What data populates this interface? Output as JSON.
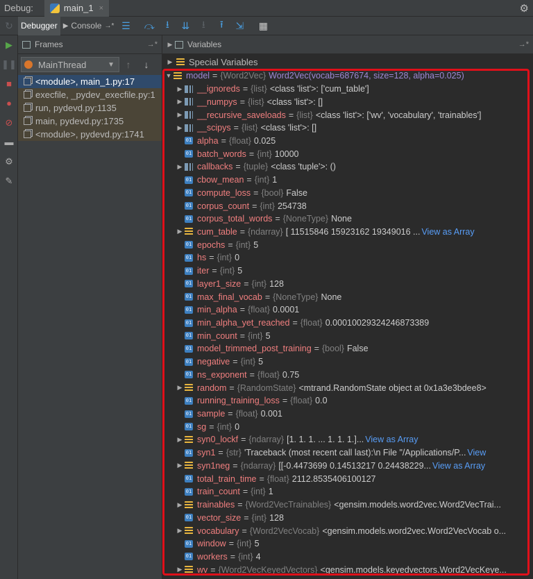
{
  "title_bar": {
    "debug_label": "Debug:",
    "run_tab_label": "main_1",
    "close_glyph": "×",
    "settings_icon": "gear-icon"
  },
  "toolbar": {
    "debugger_tab": "Debugger",
    "console_tab": "Console",
    "console_extra": "→*"
  },
  "frames": {
    "header": "Frames",
    "pin_glyph": "→*",
    "thread": "MainThread",
    "items": [
      "<module>, main_1.py:17",
      "execfile, _pydev_execfile.py:1",
      "run, pydevd.py:1135",
      "main, pydevd.py:1735",
      "<module>, pydevd.py:1741"
    ]
  },
  "variables": {
    "header": "Variables",
    "pin_glyph": "→*",
    "special": "Special Variables",
    "root": {
      "name": "model",
      "type": "{Word2Vec}",
      "value": "Word2Vec(vocab=687674, size=128, alpha=0.025)"
    },
    "rows": [
      {
        "name": "__ignoreds",
        "type": "{list}",
        "value": "<class 'list'>: ['cum_table']",
        "icon": "list",
        "expandable": true
      },
      {
        "name": "__numpys",
        "type": "{list}",
        "value": "<class 'list'>: []",
        "icon": "list",
        "expandable": true
      },
      {
        "name": "__recursive_saveloads",
        "type": "{list}",
        "value": "<class 'list'>: ['wv', 'vocabulary', 'trainables']",
        "icon": "list",
        "expandable": true
      },
      {
        "name": "__scipys",
        "type": "{list}",
        "value": "<class 'list'>: []",
        "icon": "list",
        "expandable": true
      },
      {
        "name": "alpha",
        "type": "{float}",
        "value": "0.025",
        "icon": "num",
        "expandable": false
      },
      {
        "name": "batch_words",
        "type": "{int}",
        "value": "10000",
        "icon": "num",
        "expandable": false
      },
      {
        "name": "callbacks",
        "type": "{tuple}",
        "value": "<class 'tuple'>: ()",
        "icon": "list",
        "expandable": true
      },
      {
        "name": "cbow_mean",
        "type": "{int}",
        "value": "1",
        "icon": "num",
        "expandable": false
      },
      {
        "name": "compute_loss",
        "type": "{bool}",
        "value": "False",
        "icon": "num",
        "expandable": false
      },
      {
        "name": "corpus_count",
        "type": "{int}",
        "value": "254738",
        "icon": "num",
        "expandable": false
      },
      {
        "name": "corpus_total_words",
        "type": "{NoneType}",
        "value": "None",
        "icon": "num",
        "expandable": false
      },
      {
        "name": "cum_table",
        "type": "{ndarray}",
        "value": "[  11515846   15923162   19349016 ...",
        "link": "View as Array",
        "icon": "obj",
        "expandable": true
      },
      {
        "name": "epochs",
        "type": "{int}",
        "value": "5",
        "icon": "num",
        "expandable": false
      },
      {
        "name": "hs",
        "type": "{int}",
        "value": "0",
        "icon": "num",
        "expandable": false
      },
      {
        "name": "iter",
        "type": "{int}",
        "value": "5",
        "icon": "num",
        "expandable": false
      },
      {
        "name": "layer1_size",
        "type": "{int}",
        "value": "128",
        "icon": "num",
        "expandable": false
      },
      {
        "name": "max_final_vocab",
        "type": "{NoneType}",
        "value": "None",
        "icon": "num",
        "expandable": false
      },
      {
        "name": "min_alpha",
        "type": "{float}",
        "value": "0.0001",
        "icon": "num",
        "expandable": false
      },
      {
        "name": "min_alpha_yet_reached",
        "type": "{float}",
        "value": "0.00010029324246873389",
        "icon": "num",
        "expandable": false
      },
      {
        "name": "min_count",
        "type": "{int}",
        "value": "5",
        "icon": "num",
        "expandable": false
      },
      {
        "name": "model_trimmed_post_training",
        "type": "{bool}",
        "value": "False",
        "icon": "num",
        "expandable": false
      },
      {
        "name": "negative",
        "type": "{int}",
        "value": "5",
        "icon": "num",
        "expandable": false
      },
      {
        "name": "ns_exponent",
        "type": "{float}",
        "value": "0.75",
        "icon": "num",
        "expandable": false
      },
      {
        "name": "random",
        "type": "{RandomState}",
        "value": "<mtrand.RandomState object at 0x1a3e3bdee8>",
        "icon": "obj",
        "expandable": true
      },
      {
        "name": "running_training_loss",
        "type": "{float}",
        "value": "0.0",
        "icon": "num",
        "expandable": false
      },
      {
        "name": "sample",
        "type": "{float}",
        "value": "0.001",
        "icon": "num",
        "expandable": false
      },
      {
        "name": "sg",
        "type": "{int}",
        "value": "0",
        "icon": "num",
        "expandable": false
      },
      {
        "name": "syn0_lockf",
        "type": "{ndarray}",
        "value": "[1. 1. 1. ... 1. 1. 1.]...",
        "link": "View as Array",
        "icon": "obj",
        "expandable": true
      },
      {
        "name": "syn1",
        "type": "{str}",
        "value": "'Traceback (most recent call last):\\n  File \"/Applications/P...",
        "link": "View",
        "icon": "num",
        "expandable": false
      },
      {
        "name": "syn1neg",
        "type": "{ndarray}",
        "value": "[[-0.4473699   0.14513217  0.24438229...",
        "link": "View as Array",
        "icon": "obj",
        "expandable": true
      },
      {
        "name": "total_train_time",
        "type": "{float}",
        "value": "2112.8535406100127",
        "icon": "num",
        "expandable": false
      },
      {
        "name": "train_count",
        "type": "{int}",
        "value": "1",
        "icon": "num",
        "expandable": false
      },
      {
        "name": "trainables",
        "type": "{Word2VecTrainables}",
        "value": "<gensim.models.word2vec.Word2VecTrai...",
        "icon": "obj",
        "expandable": true
      },
      {
        "name": "vector_size",
        "type": "{int}",
        "value": "128",
        "icon": "num",
        "expandable": false
      },
      {
        "name": "vocabulary",
        "type": "{Word2VecVocab}",
        "value": "<gensim.models.word2vec.Word2VecVocab o...",
        "icon": "obj",
        "expandable": true
      },
      {
        "name": "window",
        "type": "{int}",
        "value": "5",
        "icon": "num",
        "expandable": false
      },
      {
        "name": "workers",
        "type": "{int}",
        "value": "4",
        "icon": "num",
        "expandable": false
      },
      {
        "name": "wv",
        "type": "{Word2VecKeyedVectors}",
        "value": "<gensim.models.keyedvectors.Word2VecKeye...",
        "icon": "obj",
        "expandable": true
      }
    ]
  },
  "colors": {
    "highlight_border": "#e0101a",
    "var_name": "#f07f7f",
    "type_hint": "#808080",
    "link": "#589df6"
  }
}
